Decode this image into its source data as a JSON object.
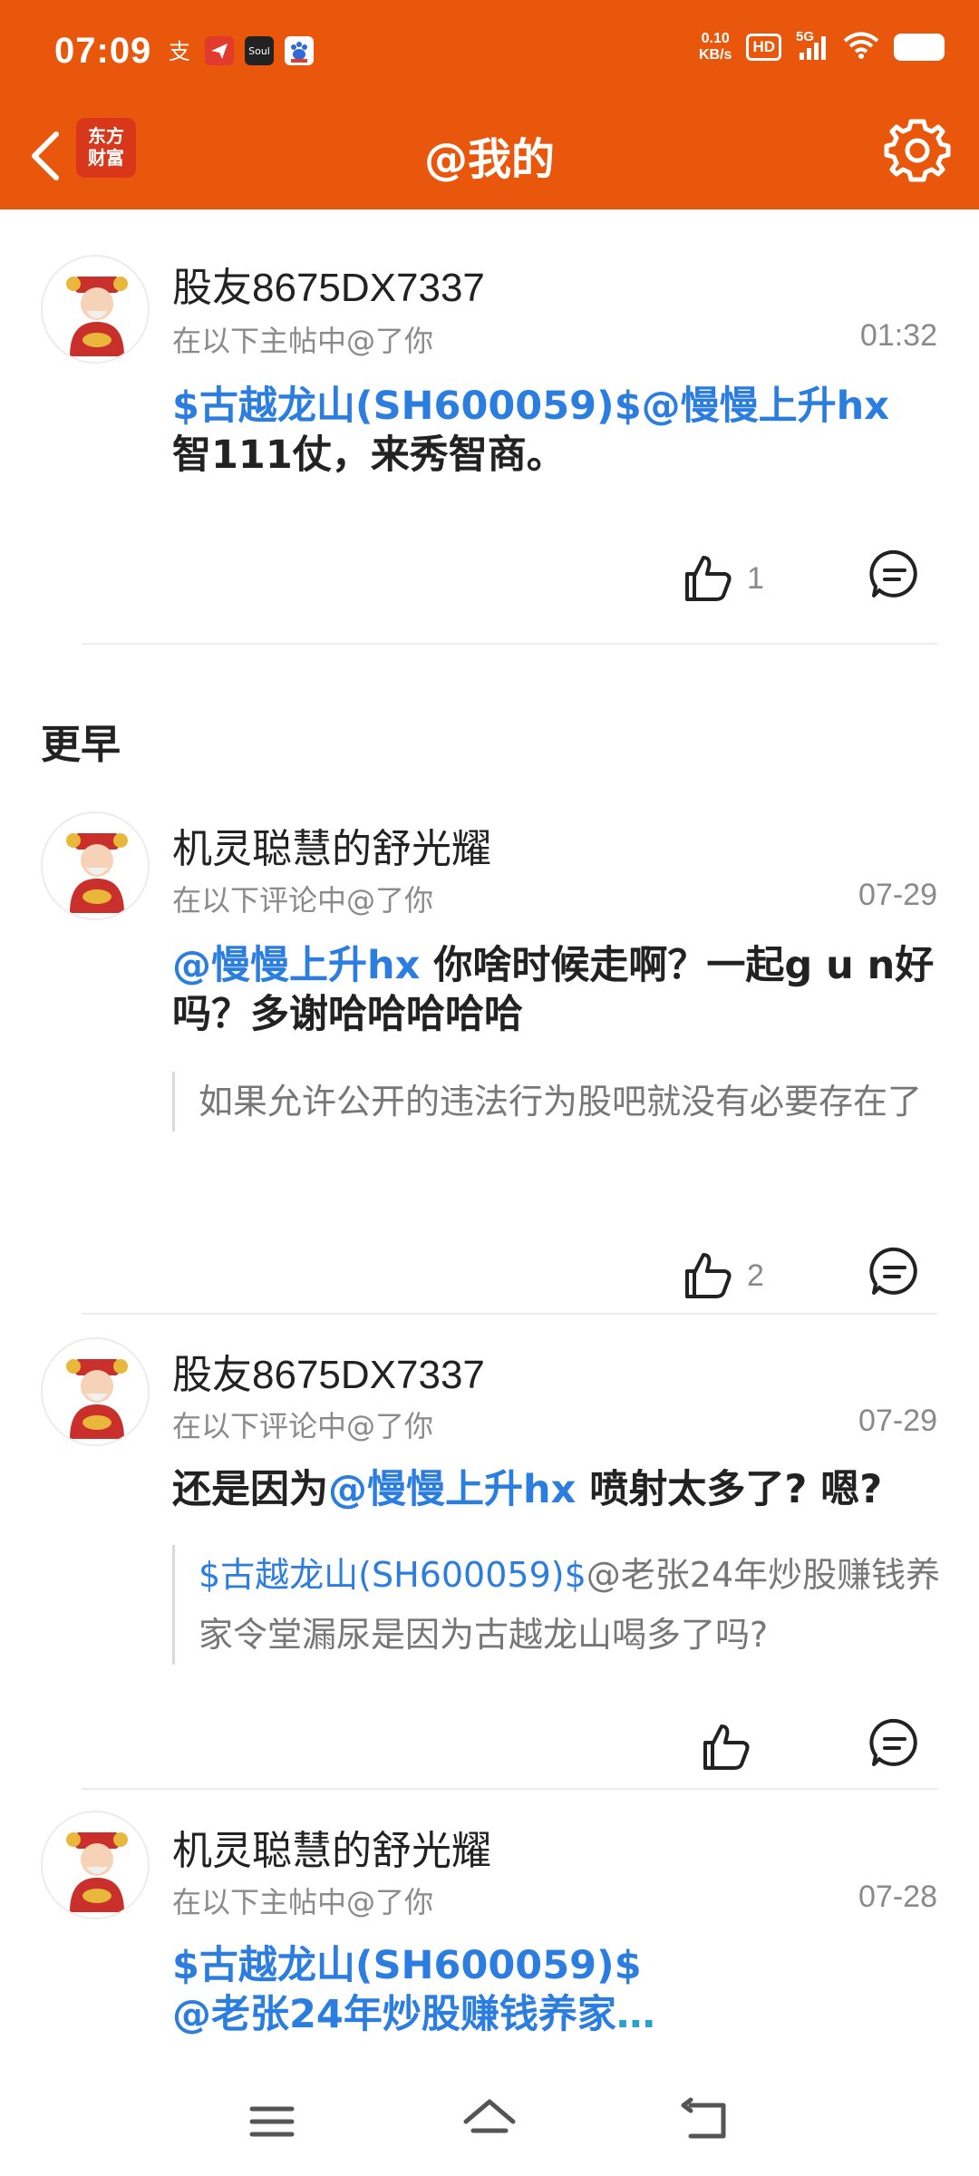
{
  "status_bar": {
    "time": "07:09",
    "net_speed_value": "0.10",
    "net_speed_unit": "KB/s",
    "hd_badge": "HD",
    "network": "5G",
    "app_icons": [
      "alipay-icon",
      "send-icon",
      "soul-app-icon",
      "baidu-icon"
    ],
    "soul_label": "Soul"
  },
  "header": {
    "title": "@我的",
    "logo_line1": "东方",
    "logo_line2": "财富"
  },
  "colors": {
    "accent": "#e8570c",
    "link": "#2b7de0",
    "muted": "#8a8a8a"
  },
  "items": [
    {
      "username": "股友8675DX7337",
      "subtitle": "在以下主帖中@了你",
      "time": "01:32",
      "body_link": "$古越龙山(SH600059)$@慢慢上升hx",
      "body_text": "智111仗，来秀智商。",
      "likes": "1"
    },
    {
      "username": "机灵聪慧的舒光耀",
      "subtitle": "在以下评论中@了你",
      "time": "07-29",
      "body_link": "@慢慢上升hx",
      "body_text": " 你啥时候走啊？一起g u n好吗？多谢哈哈哈哈哈",
      "quote": "如果允许公开的违法行为股吧就没有必要存在了",
      "likes": "2"
    },
    {
      "username": "股友8675DX7337",
      "subtitle": "在以下评论中@了你",
      "time": "07-29",
      "body_prefix": "还是因为",
      "body_link": "@慢慢上升hx",
      "body_text": " 喷射太多了? 嗯?",
      "quote_link": "$古越龙山(SH600059)$",
      "quote_text": "@老张24年炒股赚钱养家令堂漏尿是因为古越龙山喝多了吗?",
      "likes": ""
    },
    {
      "username": "机灵聪慧的舒光耀",
      "subtitle": "在以下主帖中@了你",
      "time": "07-28",
      "body_link_line1": "$古越龙山(SH600059)$",
      "body_link_line2": "@老张24年炒股赚钱养家",
      "more": "…"
    }
  ],
  "section_earlier": "更早"
}
